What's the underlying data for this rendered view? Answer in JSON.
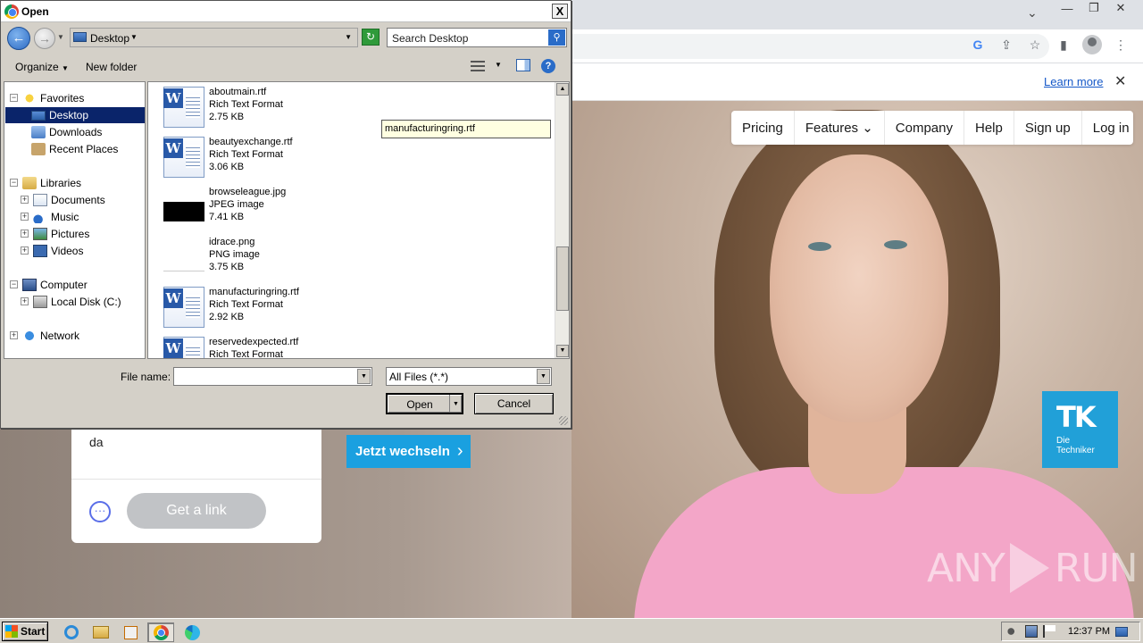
{
  "browser": {
    "window_controls": {
      "tab_dropdown": "⌄",
      "minimize": "—",
      "restore": "❐",
      "close": "✕"
    },
    "toolbar_icons": {
      "google_lens": "G",
      "share": "⇪",
      "bookmark": "☆",
      "side_panel": "▮"
    },
    "cookie_bar": {
      "learn_more": "Learn more",
      "close": "✕"
    },
    "site_nav": [
      "Pricing",
      "Features ⌄",
      "Company",
      "Help",
      "Sign up",
      "Log in"
    ],
    "widget": {
      "typed_text": "da",
      "more": "···",
      "get_link": "Get a link"
    },
    "ad": {
      "cta": "Jetzt wechseln",
      "cta_chevron": "›",
      "logo_mark": "TK",
      "logo_line1": "Die",
      "logo_line2": "Techniker"
    },
    "watermark": {
      "left": "ANY",
      "right": "RUN"
    }
  },
  "dialog": {
    "title": "Open",
    "close": "X",
    "address": {
      "back": "←",
      "forward": "→",
      "location": "Desktop",
      "dropdown": "▼"
    },
    "search_placeholder": "Search Desktop",
    "search_icon": "⚲",
    "refresh_icon": "↻",
    "commands": {
      "organize": "Organize",
      "organize_dd": "▼",
      "new_folder": "New folder",
      "views_dd": "▼",
      "help": "?"
    },
    "tree": {
      "favorites": "Favorites",
      "desktop": "Desktop",
      "downloads": "Downloads",
      "recent_places": "Recent Places",
      "libraries": "Libraries",
      "documents": "Documents",
      "music": "Music",
      "pictures": "Pictures",
      "videos": "Videos",
      "computer": "Computer",
      "local_disk": "Local Disk (C:)",
      "network": "Network"
    },
    "files": [
      {
        "name": "aboutmain.rtf",
        "type": "Rich Text Format",
        "size": "2.75 KB",
        "kind": "rtf"
      },
      {
        "name": "beautyexchange.rtf",
        "type": "Rich Text Format",
        "size": "3.06 KB",
        "kind": "rtf"
      },
      {
        "name": "browseleague.jpg",
        "type": "JPEG image",
        "size": "7.41 KB",
        "kind": "jpg"
      },
      {
        "name": "idrace.png",
        "type": "PNG image",
        "size": "3.75 KB",
        "kind": "png"
      },
      {
        "name": "manufacturingring.rtf",
        "type": "Rich Text Format",
        "size": "2.92 KB",
        "kind": "rtf"
      },
      {
        "name": "reservedexpected.rtf",
        "type": "Rich Text Format",
        "size": "",
        "kind": "rtf"
      }
    ],
    "tooltip": "manufacturingring.rtf",
    "scroll_up": "▲",
    "scroll_down": "▼",
    "file_name_label": "File name:",
    "file_name_value": "",
    "file_type": "All Files (*.*)",
    "open_button": "Open",
    "cancel_button": "Cancel"
  },
  "taskbar": {
    "start": "Start",
    "clock": "12:37 PM"
  }
}
